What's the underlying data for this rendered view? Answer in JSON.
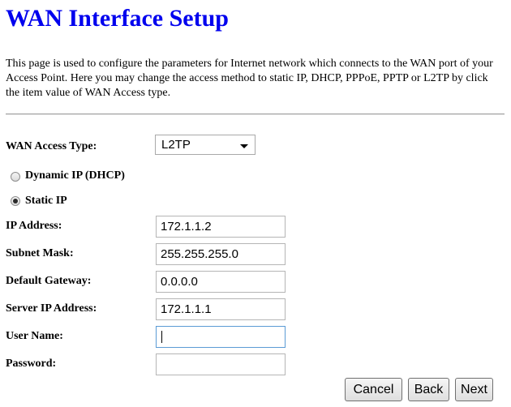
{
  "page": {
    "title": "WAN Interface Setup",
    "description": "This page is used to configure the parameters for Internet network which connects to the WAN port of your Access Point. Here you may change the access method to static IP, DHCP, PPPoE, PPTP or L2TP by click the item value of WAN Access type."
  },
  "wan_access": {
    "label": "WAN Access Type:",
    "selected": "L2TP"
  },
  "ip_mode": {
    "dhcp_label": "Dynamic IP (DHCP)",
    "static_label": "Static IP",
    "selected": "static"
  },
  "fields": {
    "ip_address": {
      "label": "IP Address:",
      "value": "172.1.1.2"
    },
    "subnet_mask": {
      "label": "Subnet Mask:",
      "value": "255.255.255.0"
    },
    "default_gateway": {
      "label": "Default Gateway:",
      "value": "0.0.0.0"
    },
    "server_ip": {
      "label": "Server IP Address:",
      "value": "172.1.1.1"
    },
    "user_name": {
      "label": "User Name:",
      "value": ""
    },
    "password": {
      "label": "Password:",
      "value": ""
    }
  },
  "buttons": {
    "cancel": "Cancel",
    "back": "Back",
    "next": "Next"
  }
}
